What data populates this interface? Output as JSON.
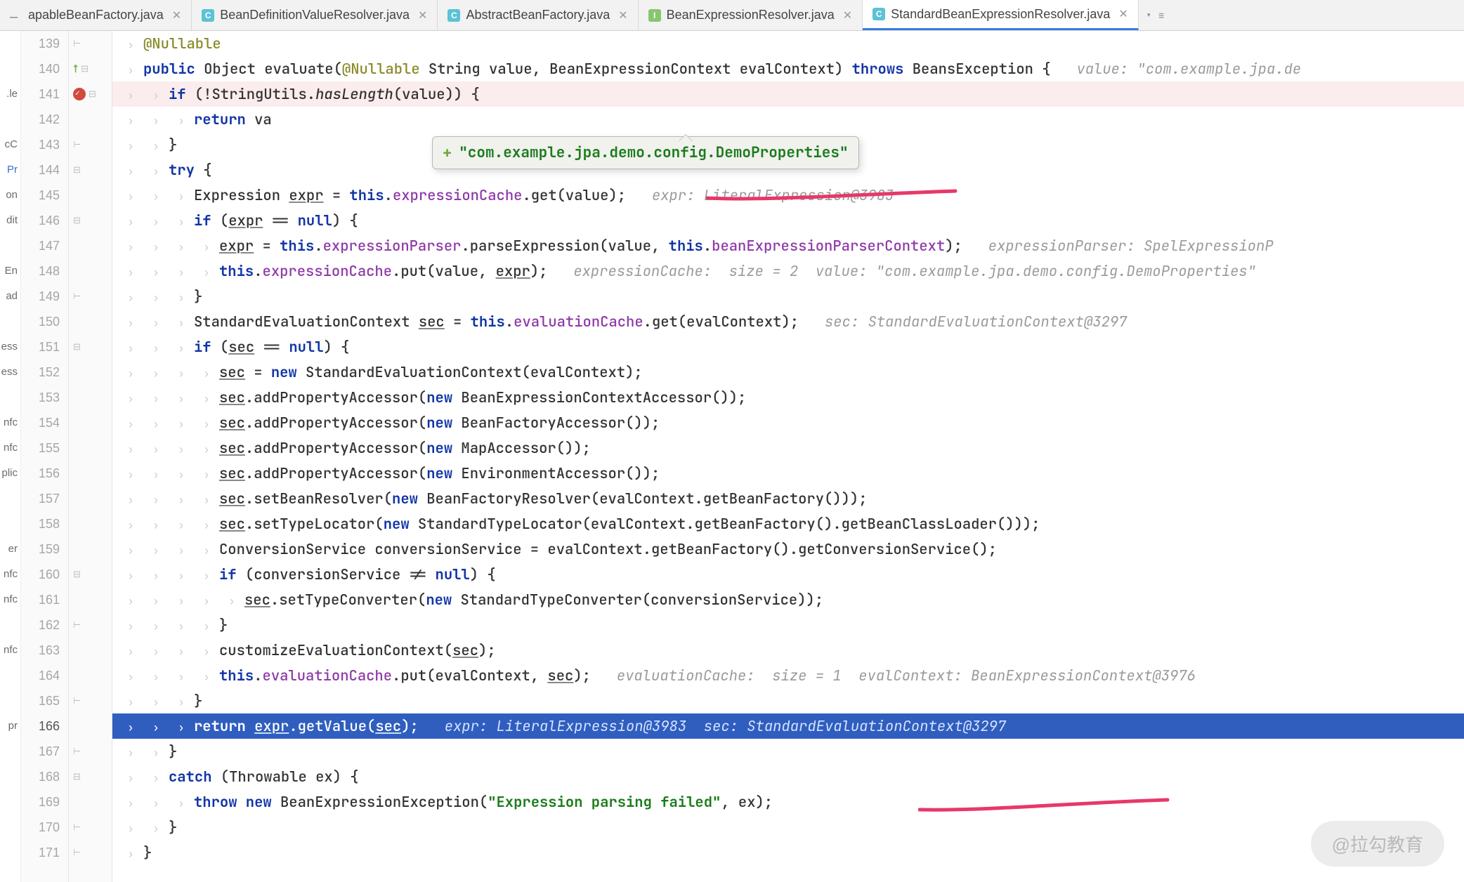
{
  "tabs": [
    {
      "label": "apableBeanFactory.java",
      "icon": "dash",
      "active": false
    },
    {
      "label": "BeanDefinitionValueResolver.java",
      "icon": "c",
      "active": false
    },
    {
      "label": "AbstractBeanFactory.java",
      "icon": "c",
      "active": false
    },
    {
      "label": "BeanExpressionResolver.java",
      "icon": "i",
      "active": false
    },
    {
      "label": "StandardBeanExpressionResolver.java",
      "icon": "c",
      "active": true
    }
  ],
  "tooltip": "\"com.example.jpa.demo.config.DemoProperties\"",
  "left_items": [
    {
      "txt": ""
    },
    {
      "txt": ""
    },
    {
      "txt": "le.",
      "blue": false
    },
    {
      "txt": ""
    },
    {
      "txt": "cC"
    },
    {
      "txt": "Pr",
      "blue": true
    },
    {
      "txt": "on"
    },
    {
      "txt": "dit"
    },
    {
      "txt": ""
    },
    {
      "txt": "En"
    },
    {
      "txt": "ad"
    },
    {
      "txt": ""
    },
    {
      "txt": "ess"
    },
    {
      "txt": "ess"
    },
    {
      "txt": ""
    },
    {
      "txt": "nfc"
    },
    {
      "txt": "nfc"
    },
    {
      "txt": "plic"
    },
    {
      "txt": ""
    },
    {
      "txt": ""
    },
    {
      "txt": "er"
    },
    {
      "txt": "nfc"
    },
    {
      "txt": "nfc"
    },
    {
      "txt": ""
    },
    {
      "txt": "nfc"
    },
    {
      "txt": ""
    },
    {
      "txt": ""
    },
    {
      "txt": "pr"
    },
    {
      "txt": ""
    },
    {
      "txt": ""
    },
    {
      "txt": ""
    },
    {
      "txt": ""
    },
    {
      "txt": ""
    }
  ],
  "watermark": "@拉勾教育",
  "lines": [
    {
      "n": 139,
      "indent": 1,
      "html": "<span class='ann'>@Nullable</span>",
      "fold": "close"
    },
    {
      "n": 140,
      "indent": 1,
      "html": "<span class='kw'>public</span> Object evaluate(<span class='ann'>@Nullable</span> String value, BeanExpressionContext evalContext) <span class='kw'>throws</span> BeansException {   <span class='hint'>value: \"com.example.jpa.de</span>",
      "marker": "up",
      "fold": "open"
    },
    {
      "n": 141,
      "indent": 2,
      "html": "<span class='kw'>if</span> (!StringUtils.<span style='font-style:italic'>hasLength</span>(value)) {",
      "marker": "bp",
      "bg": "dim",
      "fold": "open"
    },
    {
      "n": 142,
      "indent": 3,
      "html": "<span class='kw'>return</span> va"
    },
    {
      "n": 143,
      "indent": 2,
      "html": "}",
      "fold": "close"
    },
    {
      "n": 144,
      "indent": 2,
      "html": "<span class='kw'>try</span> {",
      "fold": "open"
    },
    {
      "n": 145,
      "indent": 3,
      "html": "Expression <span class='ul'>expr</span> = <span class='kw'>this</span>.<span class='fld'>expressionCache</span>.get(value);   <span class='hint'>expr: LiteralExpression@3983</span>"
    },
    {
      "n": 146,
      "indent": 3,
      "html": "<span class='kw'>if</span> (<span class='ul'>expr</span> == <span class='kw'>null</span>) {",
      "fold": "open"
    },
    {
      "n": 147,
      "indent": 4,
      "html": "<span class='ul'>expr</span> = <span class='kw'>this</span>.<span class='fld'>expressionParser</span>.parseExpression(value, <span class='kw'>this</span>.<span class='fld'>beanExpressionParserContext</span>);   <span class='hint'>expressionParser: SpelExpressionP</span>"
    },
    {
      "n": 148,
      "indent": 4,
      "html": "<span class='kw'>this</span>.<span class='fld'>expressionCache</span>.put(value, <span class='ul'>expr</span>);   <span class='hint'>expressionCache:  size = 2  value: \"com.example.jpa.demo.config.DemoProperties\"</span>"
    },
    {
      "n": 149,
      "indent": 3,
      "html": "}",
      "fold": "close"
    },
    {
      "n": 150,
      "indent": 3,
      "html": "StandardEvaluationContext <span class='ul'>sec</span> = <span class='kw'>this</span>.<span class='fld'>evaluationCache</span>.get(evalContext);   <span class='hint'>sec: StandardEvaluationContext@3297</span>"
    },
    {
      "n": 151,
      "indent": 3,
      "html": "<span class='kw'>if</span> (<span class='ul'>sec</span> == <span class='kw'>null</span>) {",
      "fold": "open"
    },
    {
      "n": 152,
      "indent": 4,
      "html": "<span class='ul'>sec</span> = <span class='kw'>new</span> StandardEvaluationContext(evalContext);"
    },
    {
      "n": 153,
      "indent": 4,
      "html": "<span class='ul'>sec</span>.addPropertyAccessor(<span class='kw'>new</span> BeanExpressionContextAccessor());"
    },
    {
      "n": 154,
      "indent": 4,
      "html": "<span class='ul'>sec</span>.addPropertyAccessor(<span class='kw'>new</span> BeanFactoryAccessor());"
    },
    {
      "n": 155,
      "indent": 4,
      "html": "<span class='ul'>sec</span>.addPropertyAccessor(<span class='kw'>new</span> MapAccessor());"
    },
    {
      "n": 156,
      "indent": 4,
      "html": "<span class='ul'>sec</span>.addPropertyAccessor(<span class='kw'>new</span> EnvironmentAccessor());"
    },
    {
      "n": 157,
      "indent": 4,
      "html": "<span class='ul'>sec</span>.setBeanResolver(<span class='kw'>new</span> BeanFactoryResolver(evalContext.getBeanFactory()));"
    },
    {
      "n": 158,
      "indent": 4,
      "html": "<span class='ul'>sec</span>.setTypeLocator(<span class='kw'>new</span> StandardTypeLocator(evalContext.getBeanFactory().getBeanClassLoader()));"
    },
    {
      "n": 159,
      "indent": 4,
      "html": "ConversionService conversionService = evalContext.getBeanFactory().getConversionService();"
    },
    {
      "n": 160,
      "indent": 4,
      "html": "<span class='kw'>if</span> (conversionService != <span class='kw'>null</span>) {",
      "fold": "open"
    },
    {
      "n": 161,
      "indent": 5,
      "html": "<span class='ul'>sec</span>.setTypeConverter(<span class='kw'>new</span> StandardTypeConverter(conversionService));"
    },
    {
      "n": 162,
      "indent": 4,
      "html": "}",
      "fold": "close"
    },
    {
      "n": 163,
      "indent": 4,
      "html": "customizeEvaluationContext(<span class='ul'>sec</span>);"
    },
    {
      "n": 164,
      "indent": 4,
      "html": "<span class='kw'>this</span>.<span class='fld'>evaluationCache</span>.put(evalContext, <span class='ul'>sec</span>);   <span class='hint'>evaluationCache:  size = 1  evalContext: BeanExpressionContext@3976</span>"
    },
    {
      "n": 165,
      "indent": 3,
      "html": "}",
      "fold": "close"
    },
    {
      "n": 166,
      "indent": 3,
      "html": "<span class='kw'>return</span> <span class='ul'>expr</span>.getValue(<span class='ul'>sec</span>);   <span class='hint'>expr: LiteralExpression@3983  sec: StandardEvaluationContext@3297</span>",
      "bg": "exec",
      "gut": "now"
    },
    {
      "n": 167,
      "indent": 2,
      "html": "}",
      "fold": "close"
    },
    {
      "n": 168,
      "indent": 2,
      "html": "<span class='kw'>catch</span> (Throwable ex) {",
      "fold": "open"
    },
    {
      "n": 169,
      "indent": 3,
      "html": "<span class='kw'>throw new</span> BeanExpressionException(<span class='str'>\"Expression parsing failed\"</span>, ex);"
    },
    {
      "n": 170,
      "indent": 2,
      "html": "}",
      "fold": "close"
    },
    {
      "n": 171,
      "indent": 1,
      "html": "}",
      "fold": "close"
    }
  ]
}
